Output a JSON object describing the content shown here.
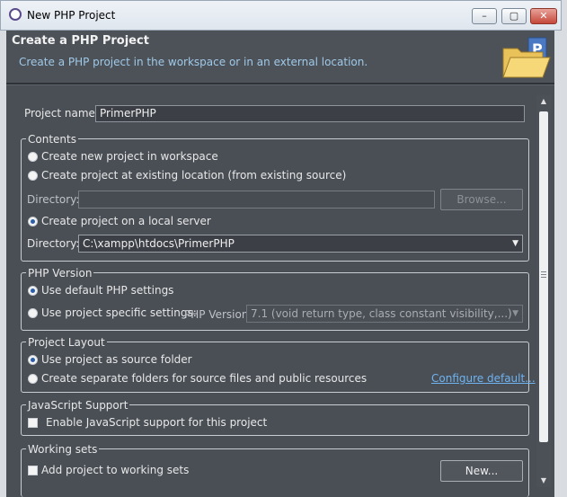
{
  "window": {
    "title": "New PHP Project",
    "minimize": "–",
    "maximize": "▢",
    "close": "✕"
  },
  "header": {
    "title": "Create a PHP Project",
    "description": "Create a PHP project in the workspace or in an external location."
  },
  "project_name": {
    "label": "Project name:",
    "value": "PrimerPHP"
  },
  "contents": {
    "title": "Contents",
    "option_new": "Create new project in workspace",
    "option_existing": "Create project at existing location (from existing source)",
    "directory_label": "Directory:",
    "directory_value": "",
    "browse_button": "Browse...",
    "option_local_server": "Create project on a local server",
    "server_directory_label": "Directory:",
    "server_directory_value": "C:\\xampp\\htdocs\\PrimerPHP",
    "selected": "local_server"
  },
  "php_version": {
    "title": "PHP Version",
    "option_default": "Use default PHP settings",
    "option_specific": "Use project specific settings:",
    "version_label": "PHP Version:",
    "version_value": "7.1 (void return type, class constant visibility,...)",
    "selected": "default"
  },
  "project_layout": {
    "title": "Project Layout",
    "option_source_folder": "Use project as source folder",
    "option_separate": "Create separate folders for source files and public resources",
    "configure_link": "Configure default...",
    "selected": "source_folder"
  },
  "javascript_support": {
    "title": "JavaScript Support",
    "checkbox_label": "Enable JavaScript support for this project",
    "checked": false
  },
  "working_sets": {
    "title": "Working sets",
    "checkbox_label": "Add project to working sets",
    "checked": false,
    "new_button": "New..."
  },
  "colors": {
    "background": "#4a4f56",
    "link": "#6fb3f0",
    "description": "#9fc9e8"
  }
}
